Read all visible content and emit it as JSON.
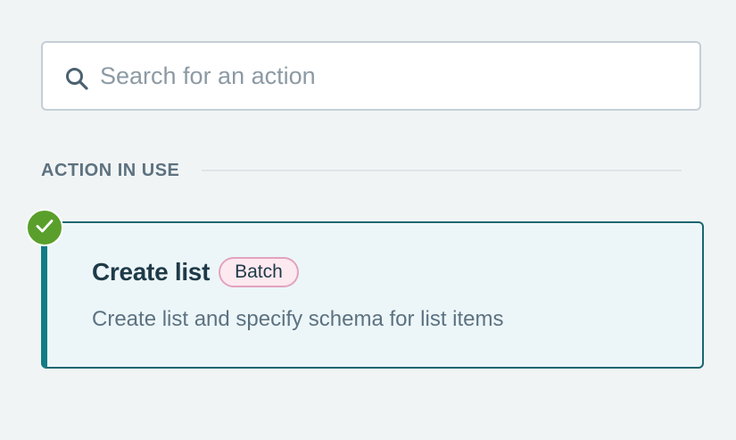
{
  "search": {
    "placeholder": "Search for an action",
    "value": ""
  },
  "section": {
    "title": "ACTION IN USE"
  },
  "action": {
    "title": "Create list",
    "badge": "Batch",
    "description": "Create list and specify schema for list items",
    "status": "selected"
  },
  "colors": {
    "background": "#f1f4f5",
    "card_background": "#ecf6f9",
    "card_accent": "#117c85",
    "check_green": "#5a9f2b",
    "badge_border": "#e2a3be",
    "badge_background": "#fde9f0"
  },
  "icons": {
    "search": "search-icon",
    "check": "check-icon"
  }
}
